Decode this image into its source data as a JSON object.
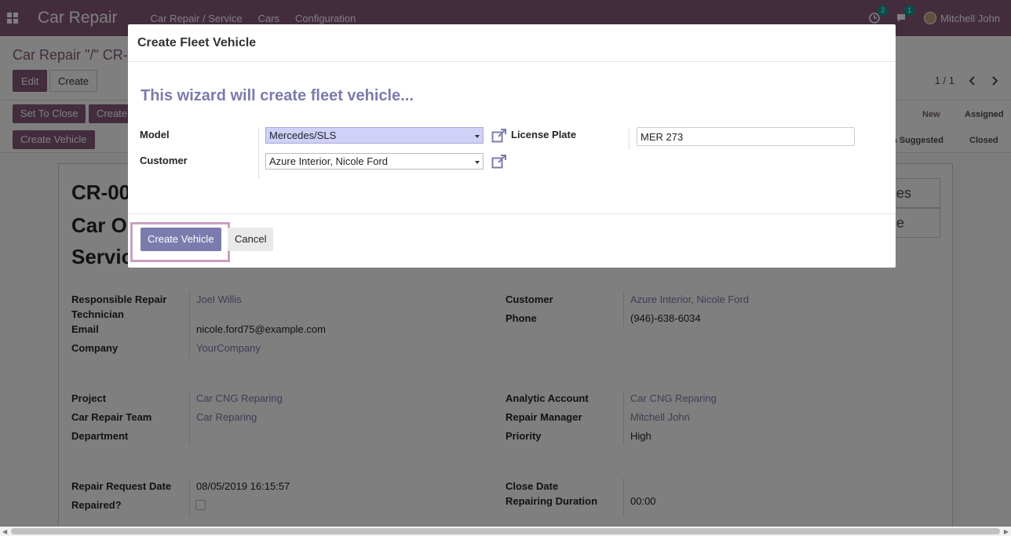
{
  "navbar": {
    "brand": "Car Repair",
    "menu": [
      "Car Repair / Service",
      "Cars",
      "Configuration"
    ],
    "activity_count": "2",
    "message_count": "1",
    "user": "Mitchell John"
  },
  "control": {
    "breadcrumb": "Car Repair \"/\" CR-",
    "edit": "Edit",
    "create": "Create",
    "pager": "1 / 1"
  },
  "statusbar": {
    "buttons": [
      "Set To Close",
      "Create",
      "Create Vehicle"
    ],
    "stages_top": [
      "New",
      "Assigned"
    ],
    "stages_bottom": [
      "n Suggested",
      "Closed"
    ]
  },
  "form": {
    "ref": "CR-00",
    "title_line1": "Car O",
    "title_line2": "Servic",
    "smart_buttons": [
      "ices",
      "cle"
    ],
    "left_group1": {
      "responsible_label_1": "Responsible Repair",
      "responsible_label_2": "Technician",
      "responsible_value": "Joel Willis",
      "email_label": "Email",
      "email_value": "nicole.ford75@example.com",
      "company_label": "Company",
      "company_value": "YourCompany"
    },
    "right_group1": {
      "customer_label": "Customer",
      "customer_value": "Azure Interior, Nicole Ford",
      "phone_label": "Phone",
      "phone_value": "(946)-638-6034"
    },
    "left_group2": {
      "project_label": "Project",
      "project_value": "Car CNG Reparing",
      "team_label": "Car Repair Team",
      "team_value": "Car Reparing",
      "department_label": "Department"
    },
    "right_group2": {
      "analytic_label": "Analytic Account",
      "analytic_value": "Car CNG Reparing",
      "manager_label": "Repair Manager",
      "manager_value": "Mitchell John",
      "priority_label": "Priority",
      "priority_value": "High"
    },
    "left_group3": {
      "request_date_label": "Repair Request Date",
      "request_date_value": "08/05/2019 16:15:57",
      "repaired_label": "Repaired?"
    },
    "right_group3": {
      "close_date_label": "Close Date",
      "duration_label": "Repairing Duration",
      "duration_value": "00:00"
    }
  },
  "modal": {
    "title": "Create Fleet Vehicle",
    "wizard_text": "This wizard will create fleet vehicle...",
    "model_label": "Model",
    "model_value": "Mercedes/SLS",
    "license_label": "License Plate",
    "license_value": "MER 273",
    "customer_label": "Customer",
    "customer_value": "Azure Interior, Nicole Ford",
    "create_button": "Create Vehicle",
    "cancel_button": "Cancel"
  },
  "colors": {
    "brand": "#875a7b",
    "link": "#7c7bad",
    "highlight": "#c99fc1"
  }
}
